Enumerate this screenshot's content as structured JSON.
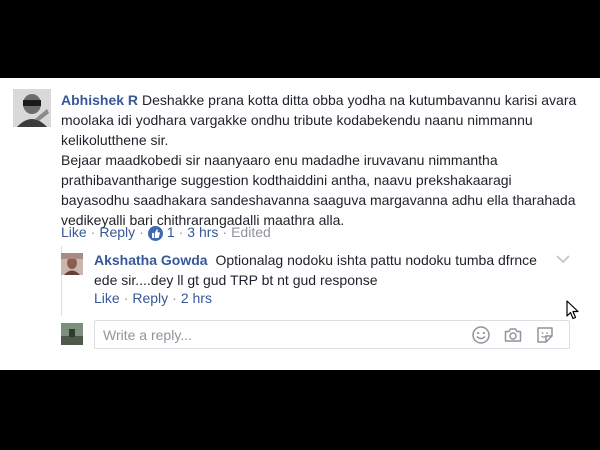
{
  "comment": {
    "author": "Abhishek R",
    "paragraph1": "Deshakke prana kotta ditta obba yodha na kutumbavannu karisi avara moolaka idi yodhara vargakke ondhu tribute kodabekendu naanu nimmannu kelikolutthene sir.",
    "paragraph2": "Bejaar maadkobedi sir naanyaaro enu madadhe iruvavanu nimmantha prathibavantharige suggestion kodthaiddini antha, naavu prekshakaaragi bayasodhu saadhakara sandeshavanna saaguva margavanna adhu ella tharahada vedikeyalli bari chithrarangadalli maathra alla.",
    "actions": {
      "like": "Like",
      "reply": "Reply",
      "reaction_count": "1",
      "time": "3 hrs",
      "edited": "Edited"
    }
  },
  "reply": {
    "author": "Akshatha Gowda",
    "text": "Optionalag nodoku ishta pattu nodoku tumba dfrnce ede sir....dey ll gt gud TRP bt nt gud response",
    "actions": {
      "like": "Like",
      "reply": "Reply",
      "time": "2 hrs"
    }
  },
  "composer": {
    "placeholder": "Write a reply..."
  },
  "icons": {
    "reaction": "like-thumb-icon",
    "options": "chevron-down-icon",
    "emoji": "smiley-icon",
    "camera": "camera-icon",
    "sticker": "sticker-icon",
    "cursor": "mouse-pointer-icon"
  },
  "colors": {
    "link": "#365899",
    "muted": "#90949c",
    "like_badge": "#4267b2"
  }
}
